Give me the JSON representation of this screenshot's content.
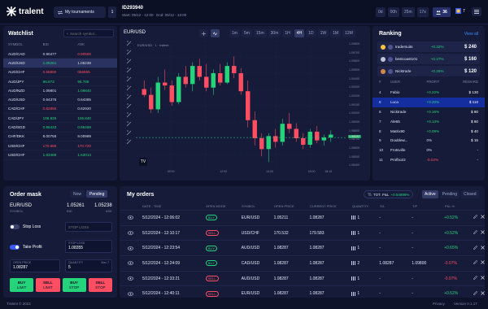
{
  "app": {
    "logo": "tralent",
    "footer_left": "Tralent © 2023",
    "footer_privacy": "Privacy",
    "footer_version": "Version 0.1.17"
  },
  "header": {
    "tournaments_label": "My tournaments",
    "tournament_count": "1",
    "tournament_id": "ID293940",
    "tournament_dates": "Start: 05/12 - 12:00   End: 05/12 - 13:00",
    "countdown": [
      "0d",
      "00h",
      "25m",
      "17s"
    ],
    "participants": "36",
    "notification_count": "7"
  },
  "watchlist": {
    "title": "Watchlist",
    "search_placeholder": "Search symbol...",
    "columns": [
      "SYMBOL",
      "BID",
      "ASK"
    ],
    "rows": [
      {
        "symbol": "AUD/CAD",
        "bid": "0.90477",
        "ask": "0.90500",
        "bid_dir": "w",
        "ask_dir": "r"
      },
      {
        "symbol": "AUD/USD",
        "bid": "1.05261",
        "ask": "1.05238",
        "bid_dir": "g",
        "ask_dir": "w"
      },
      {
        "symbol": "AUD/CHF",
        "bid": "0.56890",
        "ask": "056955",
        "bid_dir": "r",
        "ask_dir": "r"
      },
      {
        "symbol": "AUD/JPY",
        "bid": "96.673",
        "ask": "96.788",
        "bid_dir": "g",
        "ask_dir": "g"
      },
      {
        "symbol": "AUD/NZD",
        "bid": "1.09801",
        "ask": "1.09840",
        "bid_dir": "w",
        "ask_dir": "g"
      },
      {
        "symbol": "AUD/USD",
        "bid": "0.64376",
        "ask": "0.64385",
        "bid_dir": "w",
        "ask_dir": "w"
      },
      {
        "symbol": "CAD/CHF",
        "bid": "0.62865",
        "ask": "0.62920",
        "bid_dir": "r",
        "ask_dir": "w"
      },
      {
        "symbol": "CAD/JPY",
        "bid": "106.835",
        "ask": "106.840",
        "bid_dir": "g",
        "ask_dir": "g"
      },
      {
        "symbol": "CAD/SGD",
        "bid": "0.95433",
        "ask": "0.95469",
        "bid_dir": "g",
        "ask_dir": "g"
      },
      {
        "symbol": "CHF/DKK",
        "bid": "8.00758",
        "ask": "8.00989",
        "bid_dir": "w",
        "ask_dir": "w"
      },
      {
        "symbol": "USD/CHF",
        "bid": "170.685",
        "ask": "170.720",
        "bid_dir": "r",
        "ask_dir": "r"
      },
      {
        "symbol": "USD/CHF",
        "bid": "1.63488",
        "ask": "1.63014",
        "bid_dir": "g",
        "ask_dir": "g"
      }
    ]
  },
  "chart": {
    "symbol_tab": "EUR/USD",
    "legend": "EUR/USD · 1 · tralent",
    "timeframes": [
      "1m",
      "5m",
      "15m",
      "30m",
      "1H",
      "4H",
      "1D",
      "1W",
      "1M",
      "12M"
    ],
    "active_timeframe": "4H",
    "price_labels": [
      "1.09800",
      "1.09700",
      "1.09600",
      "1.09500",
      "1.09400",
      "1.09300",
      "1.09200",
      "1.09100",
      "1.09000",
      "1.08900",
      "1.08800",
      "1.08700",
      "1.08600",
      "1.08500",
      "1.08400"
    ],
    "time_labels": [
      "09:00",
      "12:00",
      "15:00",
      "18:00",
      "18:15"
    ],
    "current_price": "1.08287",
    "candles": [
      {
        "o": 1.0913,
        "h": 1.0925,
        "l": 1.0902,
        "c": 1.0905
      },
      {
        "o": 1.0905,
        "h": 1.0915,
        "l": 1.088,
        "c": 1.0885
      },
      {
        "o": 1.0885,
        "h": 1.093,
        "l": 1.088,
        "c": 1.0922
      },
      {
        "o": 1.0922,
        "h": 1.094,
        "l": 1.0912,
        "c": 1.0918
      },
      {
        "o": 1.0918,
        "h": 1.0925,
        "l": 1.089,
        "c": 1.0895
      },
      {
        "o": 1.0895,
        "h": 1.0935,
        "l": 1.0892,
        "c": 1.093
      },
      {
        "o": 1.093,
        "h": 1.0945,
        "l": 1.0915,
        "c": 1.092
      },
      {
        "o": 1.092,
        "h": 1.095,
        "l": 1.091,
        "c": 1.0945
      },
      {
        "o": 1.0945,
        "h": 1.0955,
        "l": 1.0925,
        "c": 1.093
      },
      {
        "o": 1.093,
        "h": 1.0948,
        "l": 1.091,
        "c": 1.0915
      },
      {
        "o": 1.0915,
        "h": 1.094,
        "l": 1.0905,
        "c": 1.0935
      },
      {
        "o": 1.0935,
        "h": 1.0948,
        "l": 1.0918,
        "c": 1.0922
      },
      {
        "o": 1.0922,
        "h": 1.095,
        "l": 1.092,
        "c": 1.0945
      },
      {
        "o": 1.0945,
        "h": 1.0958,
        "l": 1.0928,
        "c": 1.0935
      },
      {
        "o": 1.0935,
        "h": 1.0942,
        "l": 1.0905,
        "c": 1.091
      },
      {
        "o": 1.091,
        "h": 1.0925,
        "l": 1.086,
        "c": 1.087
      },
      {
        "o": 1.087,
        "h": 1.0882,
        "l": 1.0835,
        "c": 1.0845
      },
      {
        "o": 1.0845,
        "h": 1.0852,
        "l": 1.082,
        "c": 1.083
      },
      {
        "o": 1.083,
        "h": 1.0852,
        "l": 1.0812,
        "c": 1.0848
      },
      {
        "o": 1.0848,
        "h": 1.0858,
        "l": 1.0832,
        "c": 1.084
      },
      {
        "o": 1.084,
        "h": 1.0872,
        "l": 1.0835,
        "c": 1.0865
      },
      {
        "o": 1.0865,
        "h": 1.088,
        "l": 1.0852,
        "c": 1.0858
      },
      {
        "o": 1.0858,
        "h": 1.0866,
        "l": 1.084,
        "c": 1.0845
      },
      {
        "o": 1.0845,
        "h": 1.0852,
        "l": 1.083,
        "c": 1.0836
      },
      {
        "o": 1.0836,
        "h": 1.0858,
        "l": 1.0832,
        "c": 1.0854
      },
      {
        "o": 1.0854,
        "h": 1.0862,
        "l": 1.0838,
        "c": 1.0842
      },
      {
        "o": 1.0842,
        "h": 1.085,
        "l": 1.0835,
        "c": 1.0846
      },
      {
        "o": 1.0846,
        "h": 1.0856,
        "l": 1.084,
        "c": 1.085
      }
    ],
    "y_min": 1.08,
    "y_max": 1.098
  },
  "ranking": {
    "title": "Ranking",
    "view_all": "View all",
    "podium": [
      {
        "name": "tradersuits",
        "pct": "+0.32%",
        "reward": "$ 240"
      },
      {
        "name": "bestcoast101",
        "pct": "+0.27%",
        "reward": "$ 160"
      },
      {
        "name": "Nicktrade",
        "pct": "+0.26%",
        "reward": "$ 120"
      }
    ],
    "columns": [
      "#",
      "USER",
      "PROFIT",
      "REWARD"
    ],
    "rows": [
      {
        "rank": "4",
        "user": "Fabio",
        "profit": "+0.22%",
        "reward": "$ 130",
        "dir": "g"
      },
      {
        "rank": "5",
        "user": "Luca",
        "profit": "+0.20%",
        "reward": "$ 110",
        "dir": "g"
      },
      {
        "rank": "6",
        "user": "Nicktrade",
        "profit": "+0.16%",
        "reward": "$ 80",
        "dir": "g"
      },
      {
        "rank": "7",
        "user": "Ale65",
        "profit": "+0.13%",
        "reward": "$ 60",
        "dir": "g"
      },
      {
        "rank": "8",
        "user": "Matrix90",
        "profit": "+0.09%",
        "reward": "$ 40",
        "dir": "g"
      },
      {
        "rank": "9",
        "user": "Doublew...",
        "profit": "0%",
        "reward": "$ 15",
        "dir": "w"
      },
      {
        "rank": "10",
        "user": "Frotsville",
        "profit": "0%",
        "reward": "-",
        "dir": "w"
      },
      {
        "rank": "11",
        "user": "Profbo22",
        "profit": "-0.03%",
        "reward": "-",
        "dir": "r"
      }
    ],
    "selected_rank": "5"
  },
  "order_mask": {
    "title": "Order mask",
    "modes": [
      "Now",
      "Pending"
    ],
    "active_mode": "Pending",
    "symbol": "EUR/USD",
    "symbol_label": "SYMBOL",
    "bid": "1.05261",
    "bid_label": "BID",
    "ask": "1.05238",
    "ask_label": "ASK",
    "stop_loss_label": "Stop Loss",
    "stop_loss_placeholder": "STOP LOSS",
    "take_profit_label": "Take Profit",
    "take_profit_field_label": "STOP LOSS",
    "take_profit_value": "1.08355",
    "open_price_label": "OPEN PRICE",
    "open_price_value": "1.08287",
    "quantity_label": "QUANTITY",
    "quantity_max": "Max 7",
    "quantity_value": "5",
    "buttons": [
      {
        "top": "BUY",
        "bottom": "LIMIT",
        "color": "#24d37a"
      },
      {
        "top": "SELL",
        "bottom": "LIMIT",
        "color": "#ff4d62"
      },
      {
        "top": "BUY",
        "bottom": "STOP",
        "color": "#24d37a"
      },
      {
        "top": "SELL",
        "bottom": "STOP",
        "color": "#ff4d62"
      }
    ]
  },
  "orders": {
    "title": "My orders",
    "pnl_label": "TOT. P&L",
    "pnl_value": "+0.54899%",
    "filters": [
      "Active",
      "Pending",
      "Closed"
    ],
    "active_filter": "Active",
    "columns": [
      "DATE - TIME",
      "OPEN MODE",
      "SYMBOL",
      "OPEN PRICE",
      "CURRENT PRICE",
      "QUANTITY",
      "S/L",
      "T/P",
      "P&L %"
    ],
    "rows": [
      {
        "date": "5/12/2024 - 12:06:02",
        "mode": "BUY",
        "symbol": "EUR/USD",
        "open": "1.05211",
        "current": "1.08287",
        "qty": "1",
        "sl": "-",
        "tp": "-",
        "pnl": "+0.52%",
        "dir": "g"
      },
      {
        "date": "5/12/2024 - 12:10:17",
        "mode": "SELL",
        "symbol": "USD/CHF",
        "open": "170.532",
        "current": "179.583",
        "qty": "1",
        "sl": "-",
        "tp": "-",
        "pnl": "+0.52%",
        "dir": "g"
      },
      {
        "date": "5/12/2024 - 12:23:54",
        "mode": "BUY",
        "symbol": "AUD/USD",
        "open": "1.08287",
        "current": "1.08287",
        "qty": "1",
        "sl": "-",
        "tp": "-",
        "pnl": "+0.65%",
        "dir": "g"
      },
      {
        "date": "5/12/2024 - 12:24:09",
        "mode": "BUY",
        "symbol": "CAD/USD",
        "open": "1.08287",
        "current": "1.08287",
        "qty": "2",
        "sl": "1.08287",
        "tp": "1.09800",
        "pnl": "-0.07%",
        "dir": "r"
      },
      {
        "date": "5/12/2024 - 12:33:21",
        "mode": "SELL",
        "symbol": "AUD/USD",
        "open": "1.08287",
        "current": "1.08287",
        "qty": "1",
        "sl": "-",
        "tp": "-",
        "pnl": "-0.07%",
        "dir": "r"
      },
      {
        "date": "5/12/2024 - 12:40:11",
        "mode": "SELL",
        "symbol": "EUR/USD",
        "open": "1.08287",
        "current": "1.08287",
        "qty": "1",
        "sl": "-",
        "tp": "-",
        "pnl": "+0.52%",
        "dir": "g"
      }
    ]
  },
  "colors": {
    "bg": "#0e1329",
    "panel": "#151b38",
    "green": "#24d37a",
    "red": "#ff4d62",
    "accent": "#3a5cff"
  }
}
